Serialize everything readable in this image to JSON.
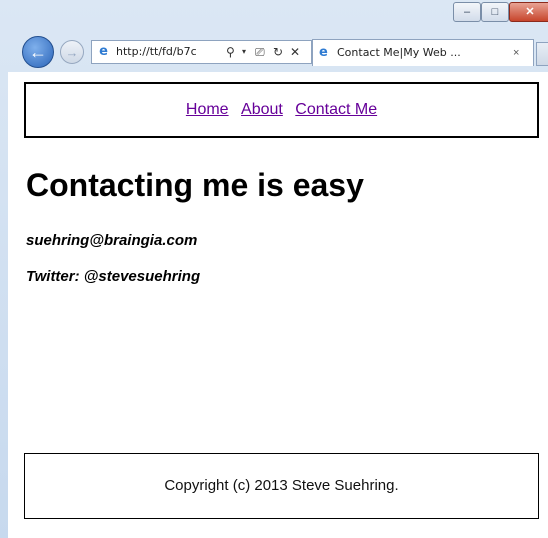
{
  "browser": {
    "address_url": "http://tt/fd/b7c",
    "tab_title": "Contact Me|My Web ...",
    "tab_close": "×",
    "controls": {
      "back": "←",
      "forward": "→",
      "search": "⚲",
      "dropdown": "▾",
      "compat": "⎚",
      "refresh": "↻",
      "stop": "✕",
      "minimize": "–",
      "maximize": "□",
      "close": "✕"
    }
  },
  "page": {
    "nav": [
      "Home",
      "About",
      "Contact Me"
    ],
    "heading": "Contacting me is easy",
    "email": "suehring@braingia.com",
    "twitter": "Twitter: @stevesuehring",
    "footer": "Copyright (c) 2013 Steve Suehring."
  },
  "icons": {
    "ie_logo": "e"
  },
  "colors": {
    "link": "#660099",
    "close_button": "#c7452c",
    "back_button": "#2a64b8"
  }
}
